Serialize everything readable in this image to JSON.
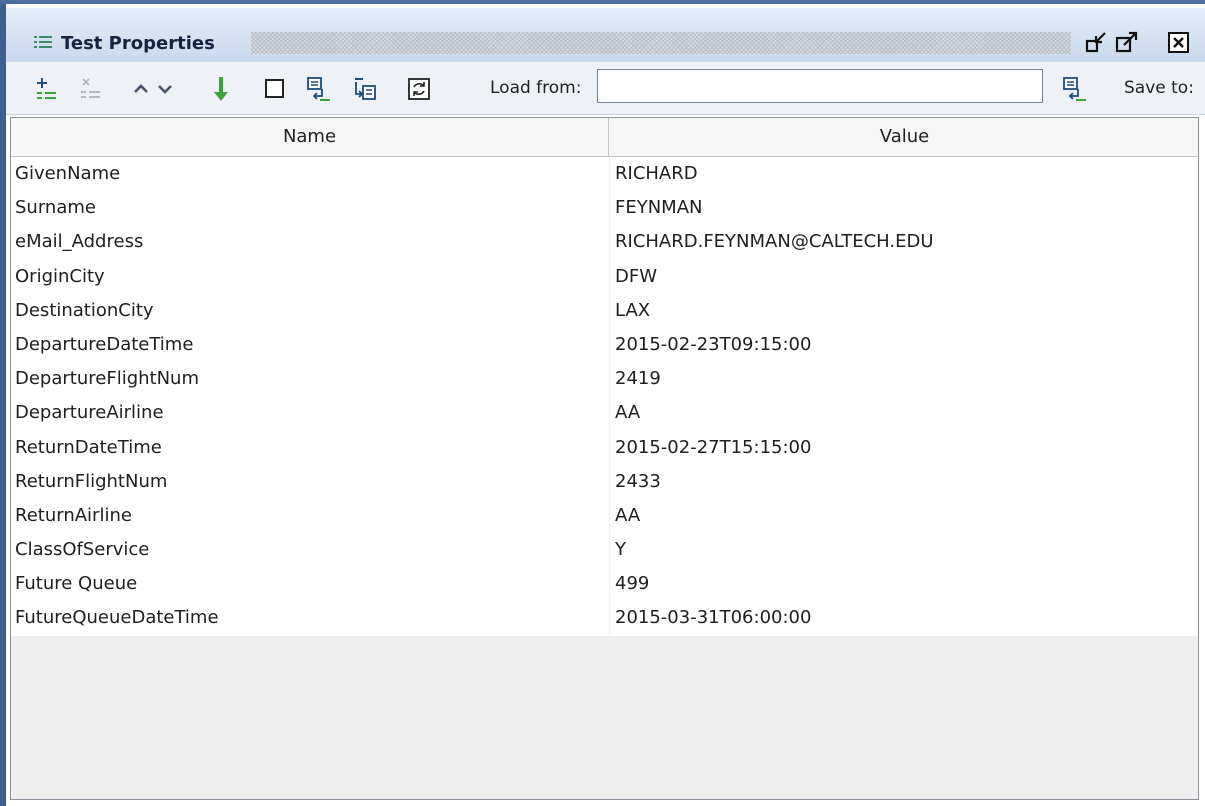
{
  "panel": {
    "title": "Test Properties",
    "icons": {
      "panel": "list-icon",
      "restore": "restore-icon",
      "maximize": "maximize-icon",
      "close": "close-icon"
    }
  },
  "toolbar": {
    "icons": [
      "add-property-icon",
      "delete-property-icon",
      "move-up-icon",
      "move-down-icon",
      "sort-down-icon",
      "blank-icon",
      "load-icon",
      "import-icon",
      "refresh-icon",
      "save-icon"
    ],
    "load_label": "Load from:",
    "load_value": "",
    "save_label": "Save to:",
    "colors": {
      "arrow_green": "#3aa43a",
      "icon_blue": "#1e4d7a"
    }
  },
  "table": {
    "columns": [
      "Name",
      "Value"
    ],
    "rows": [
      {
        "name": "GivenName",
        "value": "RICHARD"
      },
      {
        "name": "Surname",
        "value": "FEYNMAN"
      },
      {
        "name": "eMail_Address",
        "value": "RICHARD.FEYNMAN@CALTECH.EDU"
      },
      {
        "name": "OriginCity",
        "value": "DFW"
      },
      {
        "name": "DestinationCity",
        "value": "LAX"
      },
      {
        "name": "DepartureDateTime",
        "value": "2015-02-23T09:15:00"
      },
      {
        "name": "DepartureFlightNum",
        "value": "2419"
      },
      {
        "name": "DepartureAirline",
        "value": "AA"
      },
      {
        "name": "ReturnDateTime",
        "value": "2015-02-27T15:15:00"
      },
      {
        "name": "ReturnFlightNum",
        "value": "2433"
      },
      {
        "name": "ReturnAirline",
        "value": "AA"
      },
      {
        "name": "ClassOfService",
        "value": "Y"
      },
      {
        "name": "Future Queue",
        "value": "499"
      },
      {
        "name": "FutureQueueDateTime",
        "value": "2015-03-31T06:00:00"
      }
    ]
  }
}
